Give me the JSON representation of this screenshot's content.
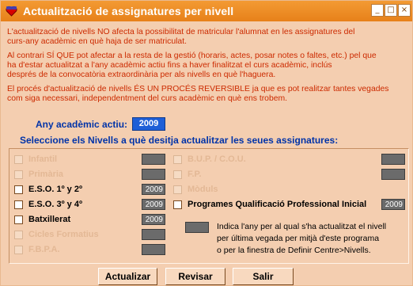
{
  "window": {
    "title": "Actualització de assignatures per nivell",
    "controls": {
      "minimize": "_",
      "maximize": "□",
      "close": "×"
    }
  },
  "messages": [
    "L'actualització de nivells NO afecta la possibilitat de matricular l'alumnat en les assignatures del",
    "curs-any acadèmic en què haja de ser matriculat.",
    "Al contrari SÍ QUE pot afectar a la resta de la gestió (horaris, actes, posar notes o faltes, etc.) pel que",
    "ha d'estar actualitzat a l'any acadèmic actiu fins a haver finalitzat el curs acadèmic, inclús",
    "després de la convocatòria extraordinària per als nivells en què l'haguera.",
    "El procés d'actualització de nivells ÉS UN PROCÉS REVERSIBLE ja que es pot realitzar tantes vegades",
    "com siga necessari, independentment del curs acadèmic en què ens trobem."
  ],
  "active_year": {
    "label": "Any acadèmic actiu:",
    "value": "2009"
  },
  "select_label": "Seleccione els Nivells a què desitja actualitzar les seues assignatures:",
  "levels_left": [
    {
      "label": "Infantil",
      "enabled": false,
      "year": ""
    },
    {
      "label": "Primària",
      "enabled": false,
      "year": ""
    },
    {
      "label": "E.S.O. 1º y 2º",
      "enabled": true,
      "year": "2009"
    },
    {
      "label": "E.S.O. 3º y 4º",
      "enabled": true,
      "year": "2009"
    },
    {
      "label": "Batxillerat",
      "enabled": true,
      "year": "2009"
    },
    {
      "label": "Cicles Formatius",
      "enabled": false,
      "year": ""
    },
    {
      "label": "F.B.P.A.",
      "enabled": false,
      "year": ""
    }
  ],
  "levels_right": [
    {
      "label": "B.U.P. / C.O.U.",
      "enabled": false,
      "year": ""
    },
    {
      "label": "F.P.",
      "enabled": false,
      "year": ""
    },
    {
      "label": "Mòduls",
      "enabled": false,
      "year": ""
    },
    {
      "label": "Programes Qualificació Professional Inicial",
      "enabled": true,
      "year": "2009"
    }
  ],
  "legend": [
    "Indica l'any per al qual s'ha actualitzat el nivell",
    "per última vegada per mitjà d'este programa",
    "o per la finestra de Definir Centre>Nivells."
  ],
  "buttons": {
    "update": "Actualizar",
    "review": "Revisar",
    "exit": "Salir"
  },
  "colors": {
    "title_bar": "#e7811a",
    "accent_text": "#0033a8",
    "message_text": "#cc2a00",
    "year_badge": "#6b6b6b"
  }
}
